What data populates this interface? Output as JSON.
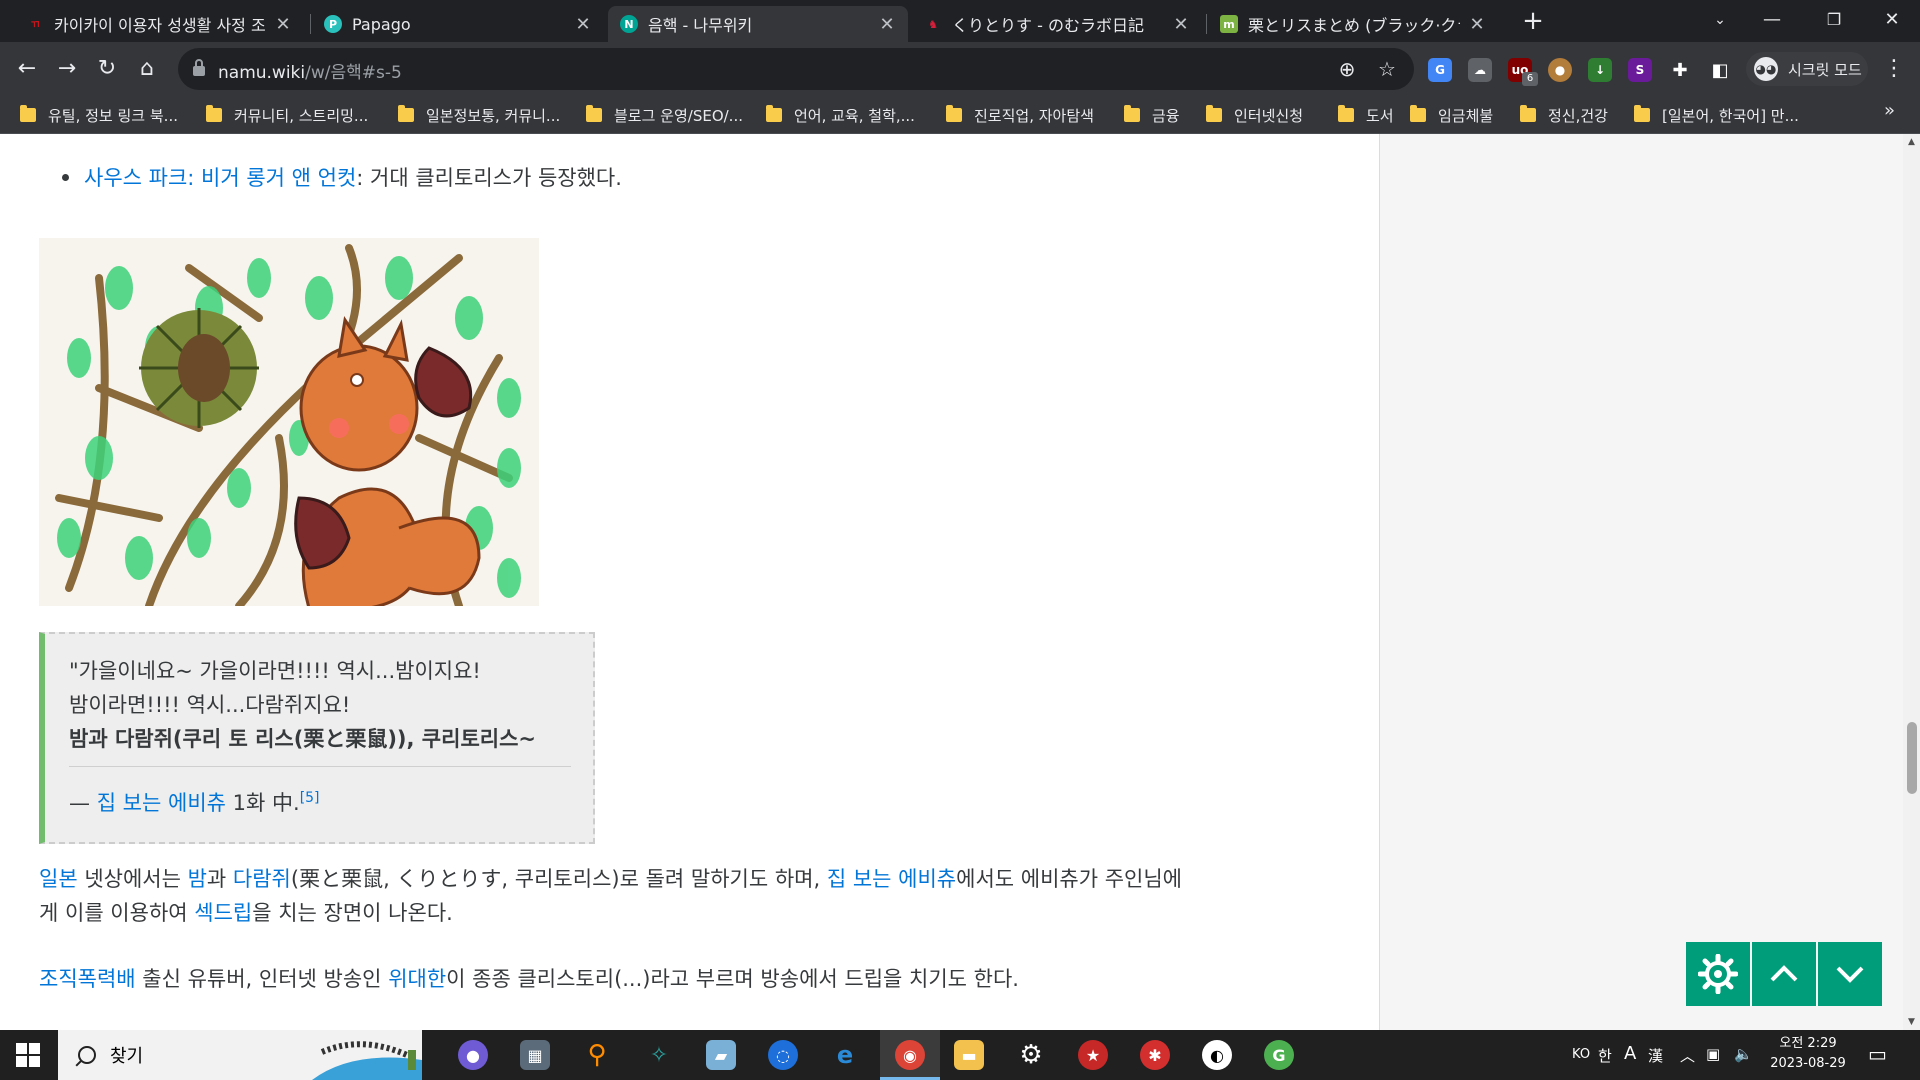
{
  "browser": {
    "tabs": [
      {
        "title": "카이카이 이용자 성생활 사정 조사",
        "favicon": "kaikai-icon",
        "color": "#c4161c",
        "active": false
      },
      {
        "title": "Papago",
        "favicon": "papago-icon",
        "color": "#2ac1bc",
        "active": false
      },
      {
        "title": "음핵 - 나무위키",
        "favicon": "namuwiki-icon",
        "color": "#00a495",
        "active": true
      },
      {
        "title": "くりとりす - のむラボ日記",
        "favicon": "nomulabo-icon",
        "color": "#d61f3b",
        "active": false
      },
      {
        "title": "栗とリスまとめ (ブラック·クラッシ…",
        "favicon": "matome-icon",
        "color": "#7cb342",
        "active": false
      }
    ],
    "url_host": "namu.wiki",
    "url_path": "/w/음핵#s-5",
    "incognito_label": "시크릿 모드",
    "extension_badge": "6",
    "bookmarks": [
      "유틸, 정보 링크 북...",
      "커뮤니티, 스트리밍...",
      "일본정보통, 커뮤니...",
      "블로그 운영/SEO/...",
      "언어, 교육, 철학,...",
      "진로직업, 자아탐색",
      "금융",
      "인터넷신청",
      "도서",
      "임금체불",
      "정신,건강",
      "[일본어, 한국어] 만..."
    ],
    "bookmarks_more": "»"
  },
  "article": {
    "bullet": {
      "link": "사우스 파크: 비거 롱거 앤 언컷",
      "text": ": 거대 클리토리스가 등장했다."
    },
    "quote": {
      "line1": "\"가을이네요~ 가을이라면!!!! 역시...밤이지요!",
      "line2": "밤이라면!!!! 역시...다람쥐지요!",
      "line3": "밤과 다람쥐(쿠리 토 리스(栗と栗鼠)), 쿠리토리스~",
      "source_prefix": "— ",
      "source_link": "집 보는 에비츄",
      "source_suffix": " 1화 中.",
      "footnote": "[5]"
    },
    "para1": {
      "l1": "일본",
      "t1": " 넷상에서는 ",
      "l2": "밤",
      "t2": "과 ",
      "l3": "다람쥐",
      "t3": "(栗と栗鼠, くりとりす, 쿠리토리스)로 돌려 말하기도 하며, ",
      "l4": "집 보는 에비츄",
      "t4": "에서도 에비츄가 주인님에",
      "t5": "게 이를 이용하여 ",
      "l5": "섹드립",
      "t6": "을 치는 장면이 나온다."
    },
    "para2": {
      "l1": "조직폭력배",
      "t1": " 출신 유튜버, 인터넷 방송인 ",
      "l2": "위대한",
      "t2": "이 종종 클리스토리(...)라고 부르며 방송에서 드립을 치기도 한다."
    }
  },
  "taskbar": {
    "search_placeholder": "찾기",
    "tray_lang": "KO",
    "tray_ime": "한",
    "tray_a": "A",
    "tray_hanja": "漢",
    "time": "오전 2:29",
    "date": "2023-08-29"
  },
  "colors": {
    "link": "#0275d8",
    "quote_bar": "#71bc6d",
    "fab": "#009d7a"
  }
}
